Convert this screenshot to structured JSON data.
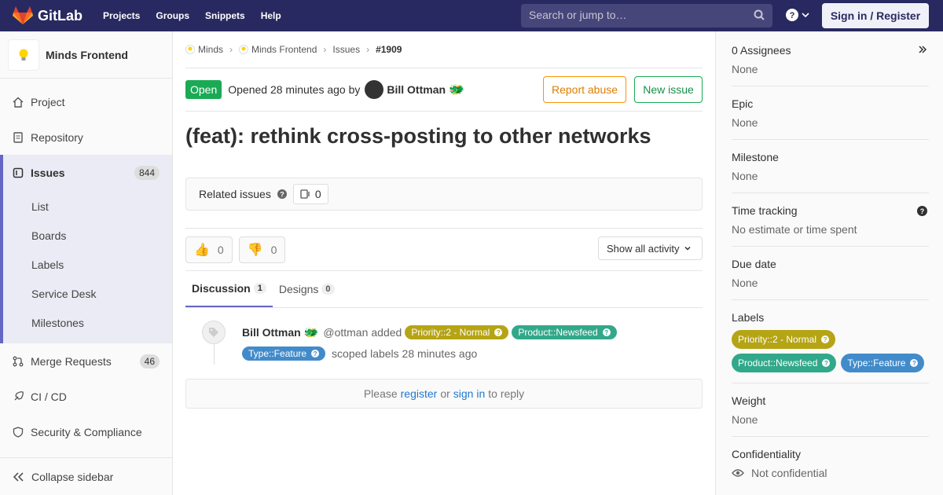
{
  "navbar": {
    "brand": "GitLab",
    "links": [
      "Projects",
      "Groups",
      "Snippets",
      "Help"
    ],
    "search_placeholder": "Search or jump to…",
    "signin_label": "Sign in / Register",
    "bg_color": "#292961"
  },
  "sidebar": {
    "project_name": "Minds Frontend",
    "items": [
      {
        "label": "Project",
        "icon": "home-icon"
      },
      {
        "label": "Repository",
        "icon": "doc-icon"
      },
      {
        "label": "Issues",
        "icon": "issues-icon",
        "count": "844"
      },
      {
        "label": "Merge Requests",
        "icon": "merge-icon",
        "count": "46"
      },
      {
        "label": "CI / CD",
        "icon": "rocket-icon"
      },
      {
        "label": "Security & Compliance",
        "icon": "shield-icon"
      }
    ],
    "issues_sub": [
      "List",
      "Boards",
      "Labels",
      "Service Desk",
      "Milestones"
    ],
    "collapse_label": "Collapse sidebar"
  },
  "breadcrumb": [
    "Minds",
    "Minds Frontend",
    "Issues",
    "#1909"
  ],
  "issue": {
    "status": "Open",
    "opened_text": "Opened 28 minutes ago by",
    "author": "Bill Ottman",
    "report_abuse": "Report abuse",
    "new_issue": "New issue",
    "title": "(feat): rethink cross-posting to other networks",
    "related_label": "Related issues",
    "related_count": "0",
    "thumbs_up": "0",
    "thumbs_down": "0",
    "activity_filter": "Show all activity",
    "tabs": [
      {
        "label": "Discussion",
        "count": "1"
      },
      {
        "label": "Designs",
        "count": "0"
      }
    ]
  },
  "note": {
    "author": "Bill Ottman",
    "handle": "@ottman",
    "action": "added",
    "labels": [
      {
        "text": "Priority::2 - Normal",
        "color": "#b5a414"
      },
      {
        "text": "Product::Newsfeed",
        "color": "#32a88a"
      },
      {
        "text": "Type::Feature",
        "color": "#428bca"
      }
    ],
    "suffix": "scoped labels 28 minutes ago"
  },
  "reply": {
    "please": "Please",
    "register": "register",
    "or": "or",
    "sign_in": "sign in",
    "to_reply": "to reply"
  },
  "right_sidebar": {
    "assignees_title": "0 Assignees",
    "assignees_value": "None",
    "epic_title": "Epic",
    "epic_value": "None",
    "milestone_title": "Milestone",
    "milestone_value": "None",
    "time_title": "Time tracking",
    "time_value": "No estimate or time spent",
    "due_title": "Due date",
    "due_value": "None",
    "labels_title": "Labels",
    "weight_title": "Weight",
    "weight_value": "None",
    "confidentiality_title": "Confidentiality",
    "confidentiality_value": "Not confidential"
  }
}
